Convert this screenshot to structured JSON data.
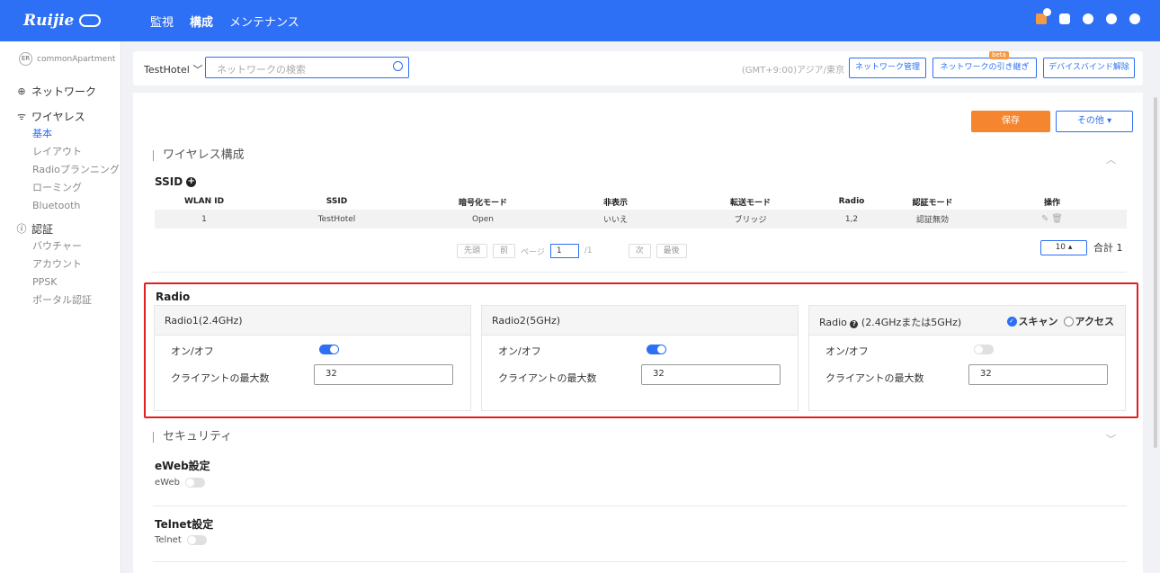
{
  "brand": {
    "name": "Ruijie",
    "sub": "Cloud"
  },
  "topnav": [
    "監視",
    "構成",
    "メンテナンス"
  ],
  "topnav_active": "構成",
  "colors": {
    "primary": "#2d6ff5",
    "accent": "#f5862f",
    "highlight_border": "#e02020"
  },
  "sidebar": {
    "project_initials": "ER",
    "project": "commonApartment",
    "groups": [
      {
        "label": "ネットワーク",
        "icon": "globe-icon"
      },
      {
        "label": "ワイヤレス",
        "icon": "wifi-icon",
        "items": [
          "基本",
          "レイアウト",
          "Radioプランニング",
          "ローミング",
          "Bluetooth"
        ]
      },
      {
        "label": "認証",
        "icon": "info-icon",
        "items": [
          "バウチャー",
          "アカウント",
          "PPSK",
          "ポータル認証"
        ]
      }
    ],
    "active_item": "基本"
  },
  "searchbar": {
    "hotel": "TestHotel",
    "search_placeholder": "ネットワークの検索",
    "timezone": "(GMT+9:00)アジア/東京",
    "btn_network_mgmt": "ネットワーク管理",
    "btn_handover": "ネットワークの引き継ぎ",
    "beta": "beta",
    "btn_unbind": "デバイスバインド解除"
  },
  "actions": {
    "save": "保存",
    "more": "その他 ▾"
  },
  "wireless_section": {
    "title": "ワイヤレス構成",
    "ssid_label": "SSID",
    "columns": [
      "WLAN ID",
      "SSID",
      "暗号化モード",
      "非表示",
      "転送モード",
      "Radio",
      "認証モード",
      "操作"
    ],
    "rows": [
      [
        "1",
        "TestHotel",
        "Open",
        "いいえ",
        "ブリッジ",
        "1,2",
        "認証無効"
      ]
    ]
  },
  "pager": {
    "first": "先頭",
    "prev": "前",
    "page_label": "ページ",
    "page": "1",
    "total_pages": "/1",
    "next": "次",
    "last": "最後",
    "page_size": "10 ▴",
    "total": "合計 1"
  },
  "radio": {
    "title": "Radio",
    "cards": [
      {
        "header": "Radio1(2.4GHz)",
        "toggle_label": "オン/オフ",
        "on": true,
        "clients_label": "クライアントの最大数",
        "clients": "32"
      },
      {
        "header": "Radio2(5GHz)",
        "toggle_label": "オン/オフ",
        "on": true,
        "clients_label": "クライアントの最大数",
        "clients": "32"
      },
      {
        "header_prefix": "Radio",
        "header_suffix": "(2.4GHzまたは5GHz)",
        "toggle_label": "オン/オフ",
        "on": false,
        "clients_label": "クライアントの最大数",
        "clients": "32",
        "mode_scan": "スキャン",
        "mode_access": "アクセス",
        "mode_selected": "スキャン"
      }
    ]
  },
  "security": {
    "title": "セキュリティ",
    "eweb_title": "eWeb設定",
    "eweb_label": "eWeb",
    "eweb_on": false,
    "telnet_title": "Telnet設定",
    "telnet_label": "Telnet",
    "telnet_on": false
  }
}
